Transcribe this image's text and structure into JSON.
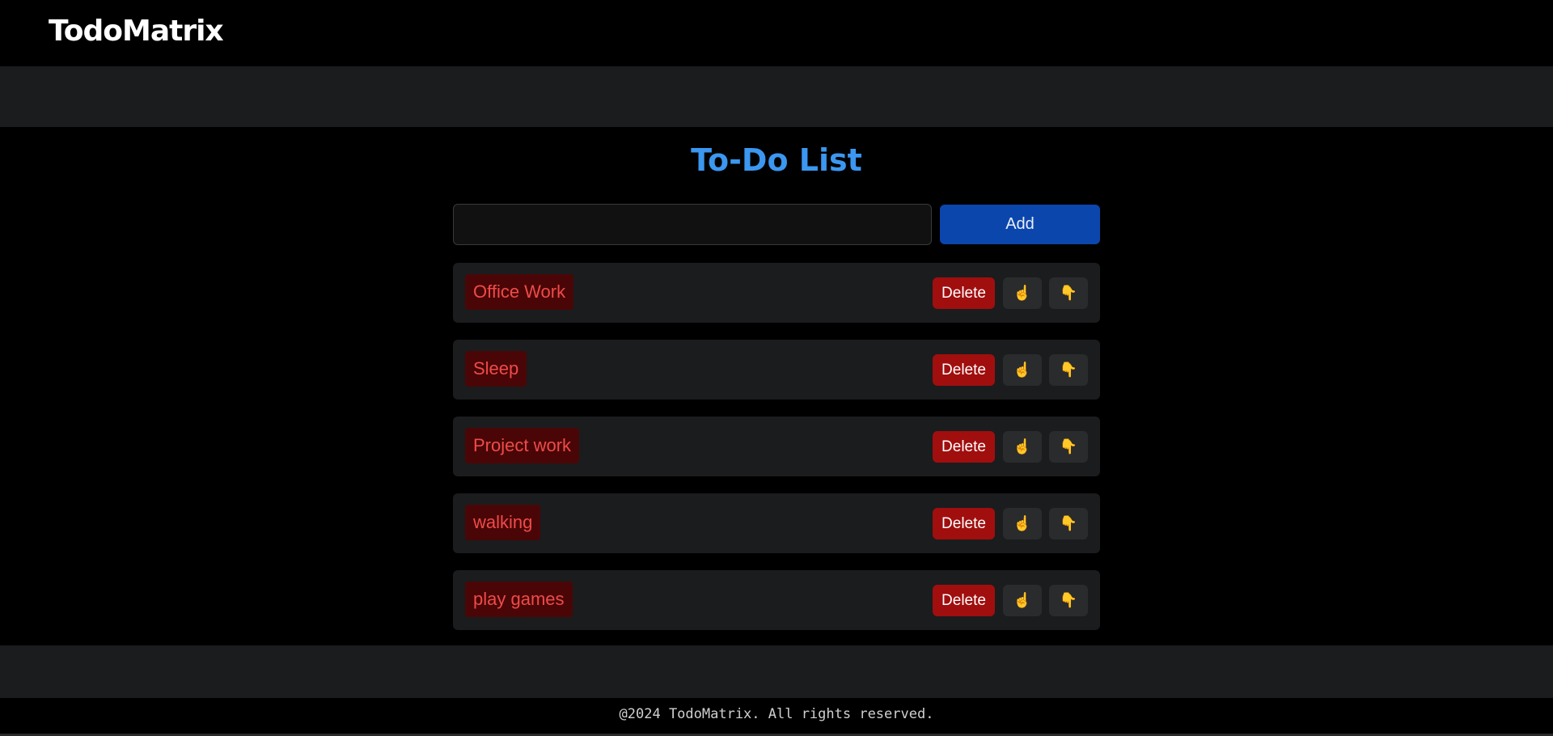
{
  "app": {
    "logo_text": "TodoMatrix"
  },
  "main": {
    "title": "To-Do List",
    "input": {
      "value": "",
      "placeholder": ""
    },
    "add_label": "Add",
    "tasks": [
      {
        "label": "Office Work",
        "delete_label": "Delete",
        "up_icon": "☝",
        "down_icon": "👇"
      },
      {
        "label": "Sleep",
        "delete_label": "Delete",
        "up_icon": "☝",
        "down_icon": "👇"
      },
      {
        "label": "Project work",
        "delete_label": "Delete",
        "up_icon": "☝",
        "down_icon": "👇"
      },
      {
        "label": "walking",
        "delete_label": "Delete",
        "up_icon": "☝",
        "down_icon": "👇"
      },
      {
        "label": "play games",
        "delete_label": "Delete",
        "up_icon": "☝",
        "down_icon": "👇"
      }
    ]
  },
  "footer": {
    "text": "@2024 TodoMatrix. All rights reserved."
  },
  "colors": {
    "title": "#3b97f0",
    "add_button": "#0b46ad",
    "delete_button": "#a10e0e",
    "task_label_bg": "#4a0606",
    "task_label_text": "#f04a4a",
    "row_bg": "#1b1c1e",
    "icon": "#f5b630"
  }
}
